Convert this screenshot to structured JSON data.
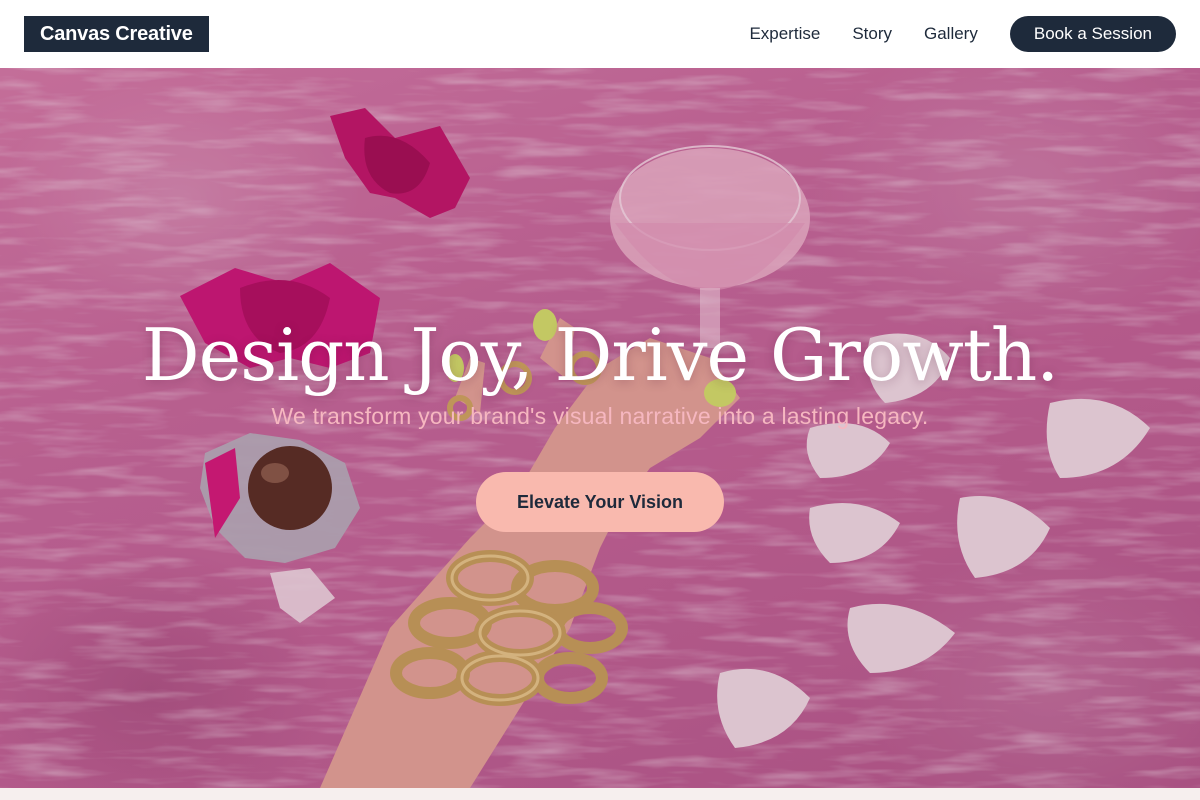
{
  "brand": {
    "name": "Canvas Creative"
  },
  "nav": {
    "links": [
      "Expertise",
      "Story",
      "Gallery"
    ],
    "cta_label": "Book a Session"
  },
  "hero": {
    "headline": "Design Joy, Drive Growth.",
    "subheadline": "We transform your brand's visual narrative into a lasting legacy.",
    "cta_label": "Elevate Your Vision",
    "image_subject": "pink fur rug with hand, gold chain bracelets, pink drink glass, wrapped candies and white petals"
  },
  "colors": {
    "navy": "#1e2a3b",
    "cta_peach": "#f9b9ae",
    "subhead_pink": "#f6b7c0",
    "hero_pink": "#c96a9d"
  }
}
